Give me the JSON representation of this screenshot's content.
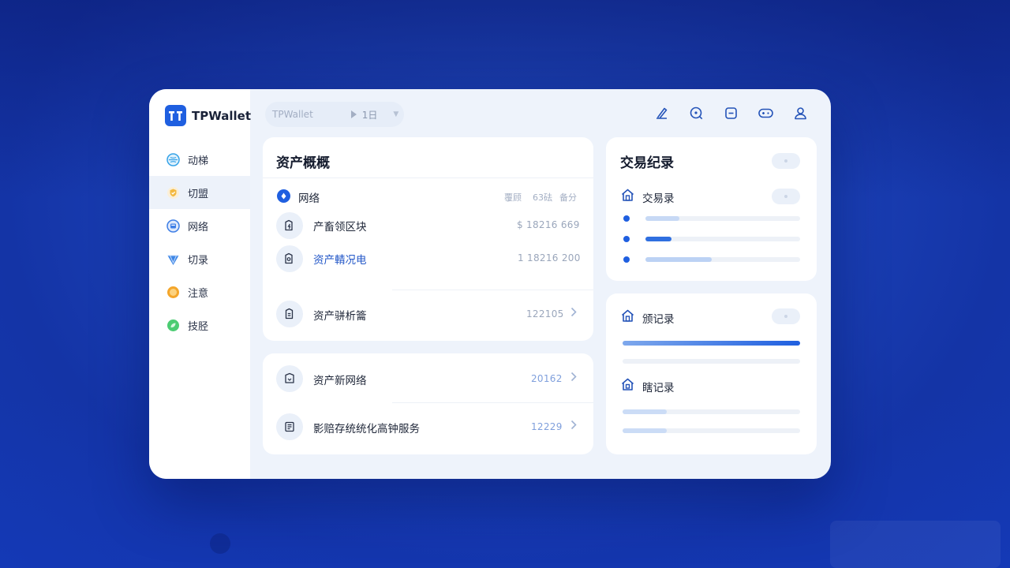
{
  "brand": {
    "logo_text": "TT",
    "name": "TPWallet"
  },
  "sidebar": {
    "items": [
      {
        "label": "动梯",
        "icon": "globe-icon",
        "color": "#36a3e8"
      },
      {
        "label": "切盟",
        "icon": "shield-check-icon",
        "color": "#e8a936"
      },
      {
        "label": "网络",
        "icon": "network-icon",
        "color": "#3f7fe6"
      },
      {
        "label": "切录",
        "icon": "diamond-icon",
        "color": "#3d86e6"
      },
      {
        "label": "注意",
        "icon": "coin-icon",
        "color": "#f0a030"
      },
      {
        "label": "技胫",
        "icon": "leaf-icon",
        "color": "#3ec46a"
      }
    ],
    "active_index": 1
  },
  "topbar": {
    "search_placeholder": "TPWallet",
    "period_label": "1日",
    "icons": [
      "edit-icon",
      "search-icon",
      "minus-square-icon",
      "gamepad-icon",
      "user-icon"
    ]
  },
  "overview": {
    "title": "资产概概",
    "network_label": "网络",
    "header_cols": [
      "覆顾",
      "63砝",
      "备分"
    ],
    "rows": [
      {
        "label": "产畜领区块",
        "value": "$ 18216 669",
        "icon": "lock-doc-icon",
        "blue": false
      },
      {
        "label": "资产輤况电",
        "value": "1 18216 200",
        "icon": "lock-doc-icon",
        "blue": true
      },
      {
        "label": "资产骈析籥",
        "value": "122105",
        "icon": "doc-icon",
        "blue": false
      }
    ]
  },
  "services": {
    "rows": [
      {
        "label": "资产新网络",
        "value": "20162",
        "icon": "shield-doc-icon"
      },
      {
        "label": "影赔存统统化高钟服务",
        "value": "12229",
        "icon": "ledger-icon"
      }
    ]
  },
  "transactions": {
    "title": "交易纪录",
    "subheader": "交易录",
    "progress": [
      0.22,
      0.17,
      0.43
    ]
  },
  "records": {
    "section1_label": "颁记录",
    "section1_progress": 1.0,
    "section2_label": "瞎记录",
    "section2_progress": [
      0.25,
      0.25
    ]
  }
}
